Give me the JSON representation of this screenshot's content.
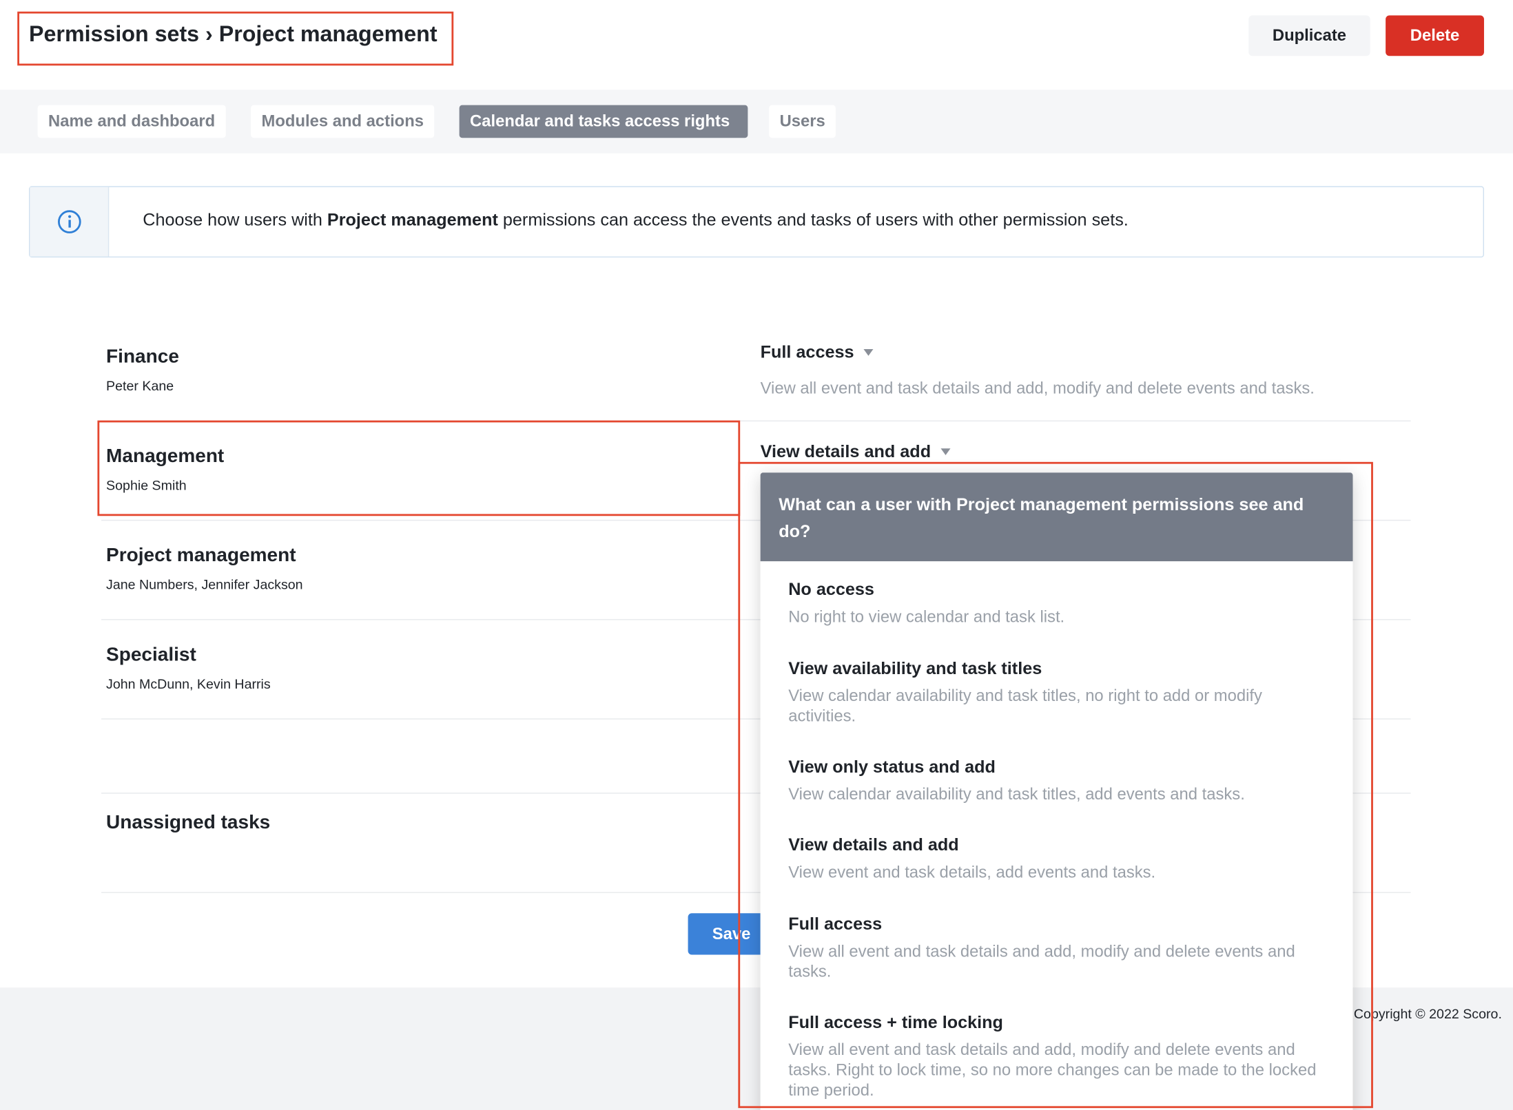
{
  "header": {
    "breadcrumb": "Permission sets › Project management",
    "duplicate_label": "Duplicate",
    "delete_label": "Delete"
  },
  "tabs": [
    {
      "label": "Name and dashboard",
      "active": false
    },
    {
      "label": "Modules and actions",
      "active": false
    },
    {
      "label": "Calendar and tasks access rights",
      "active": true
    },
    {
      "label": "Users",
      "active": false
    }
  ],
  "info": {
    "icon": "info-icon",
    "text_before": "Choose how users with ",
    "text_bold": "Project management",
    "text_after": " permissions can access the events and tasks of users with other permission sets."
  },
  "rows": [
    {
      "title": "Finance",
      "users": "Peter Kane",
      "access": "Full access",
      "access_desc": "View all event and task details and add, modify and delete events and tasks."
    },
    {
      "title": "Management",
      "users": "Sophie Smith",
      "access": "View details and add"
    },
    {
      "title": "Project management",
      "users": "Jane Numbers, Jennifer Jackson"
    },
    {
      "title": "Specialist",
      "users": "John McDunn, Kevin Harris"
    },
    {
      "title": "Unassigned tasks"
    }
  ],
  "save_label": "Save",
  "footer": {
    "copyright": "Copyright © 2022 Scoro."
  },
  "dropdown": {
    "heading": "What can a user with Project management permissions see and do?",
    "options": [
      {
        "title": "No access",
        "desc": "No right to view calendar and task list."
      },
      {
        "title": "View availability and task titles",
        "desc": "View calendar availability and task titles, no right to add or modify activities."
      },
      {
        "title": "View only status and add",
        "desc": "View calendar availability and task titles, add events and tasks."
      },
      {
        "title": "View details and add",
        "desc": "View event and task details, add events and tasks."
      },
      {
        "title": "Full access",
        "desc": "View all event and task details and add, modify and delete events and tasks."
      },
      {
        "title": "Full access + time locking",
        "desc": "View all event and task details and add, modify and delete events and tasks. Right to lock time, so no more changes can be made to the locked time period."
      }
    ]
  },
  "colors": {
    "delete": "#d93025",
    "save": "#3b82d9",
    "active_tab": "#7d838f",
    "dropdown_header": "#747b88",
    "annotation": "#e4472f"
  }
}
